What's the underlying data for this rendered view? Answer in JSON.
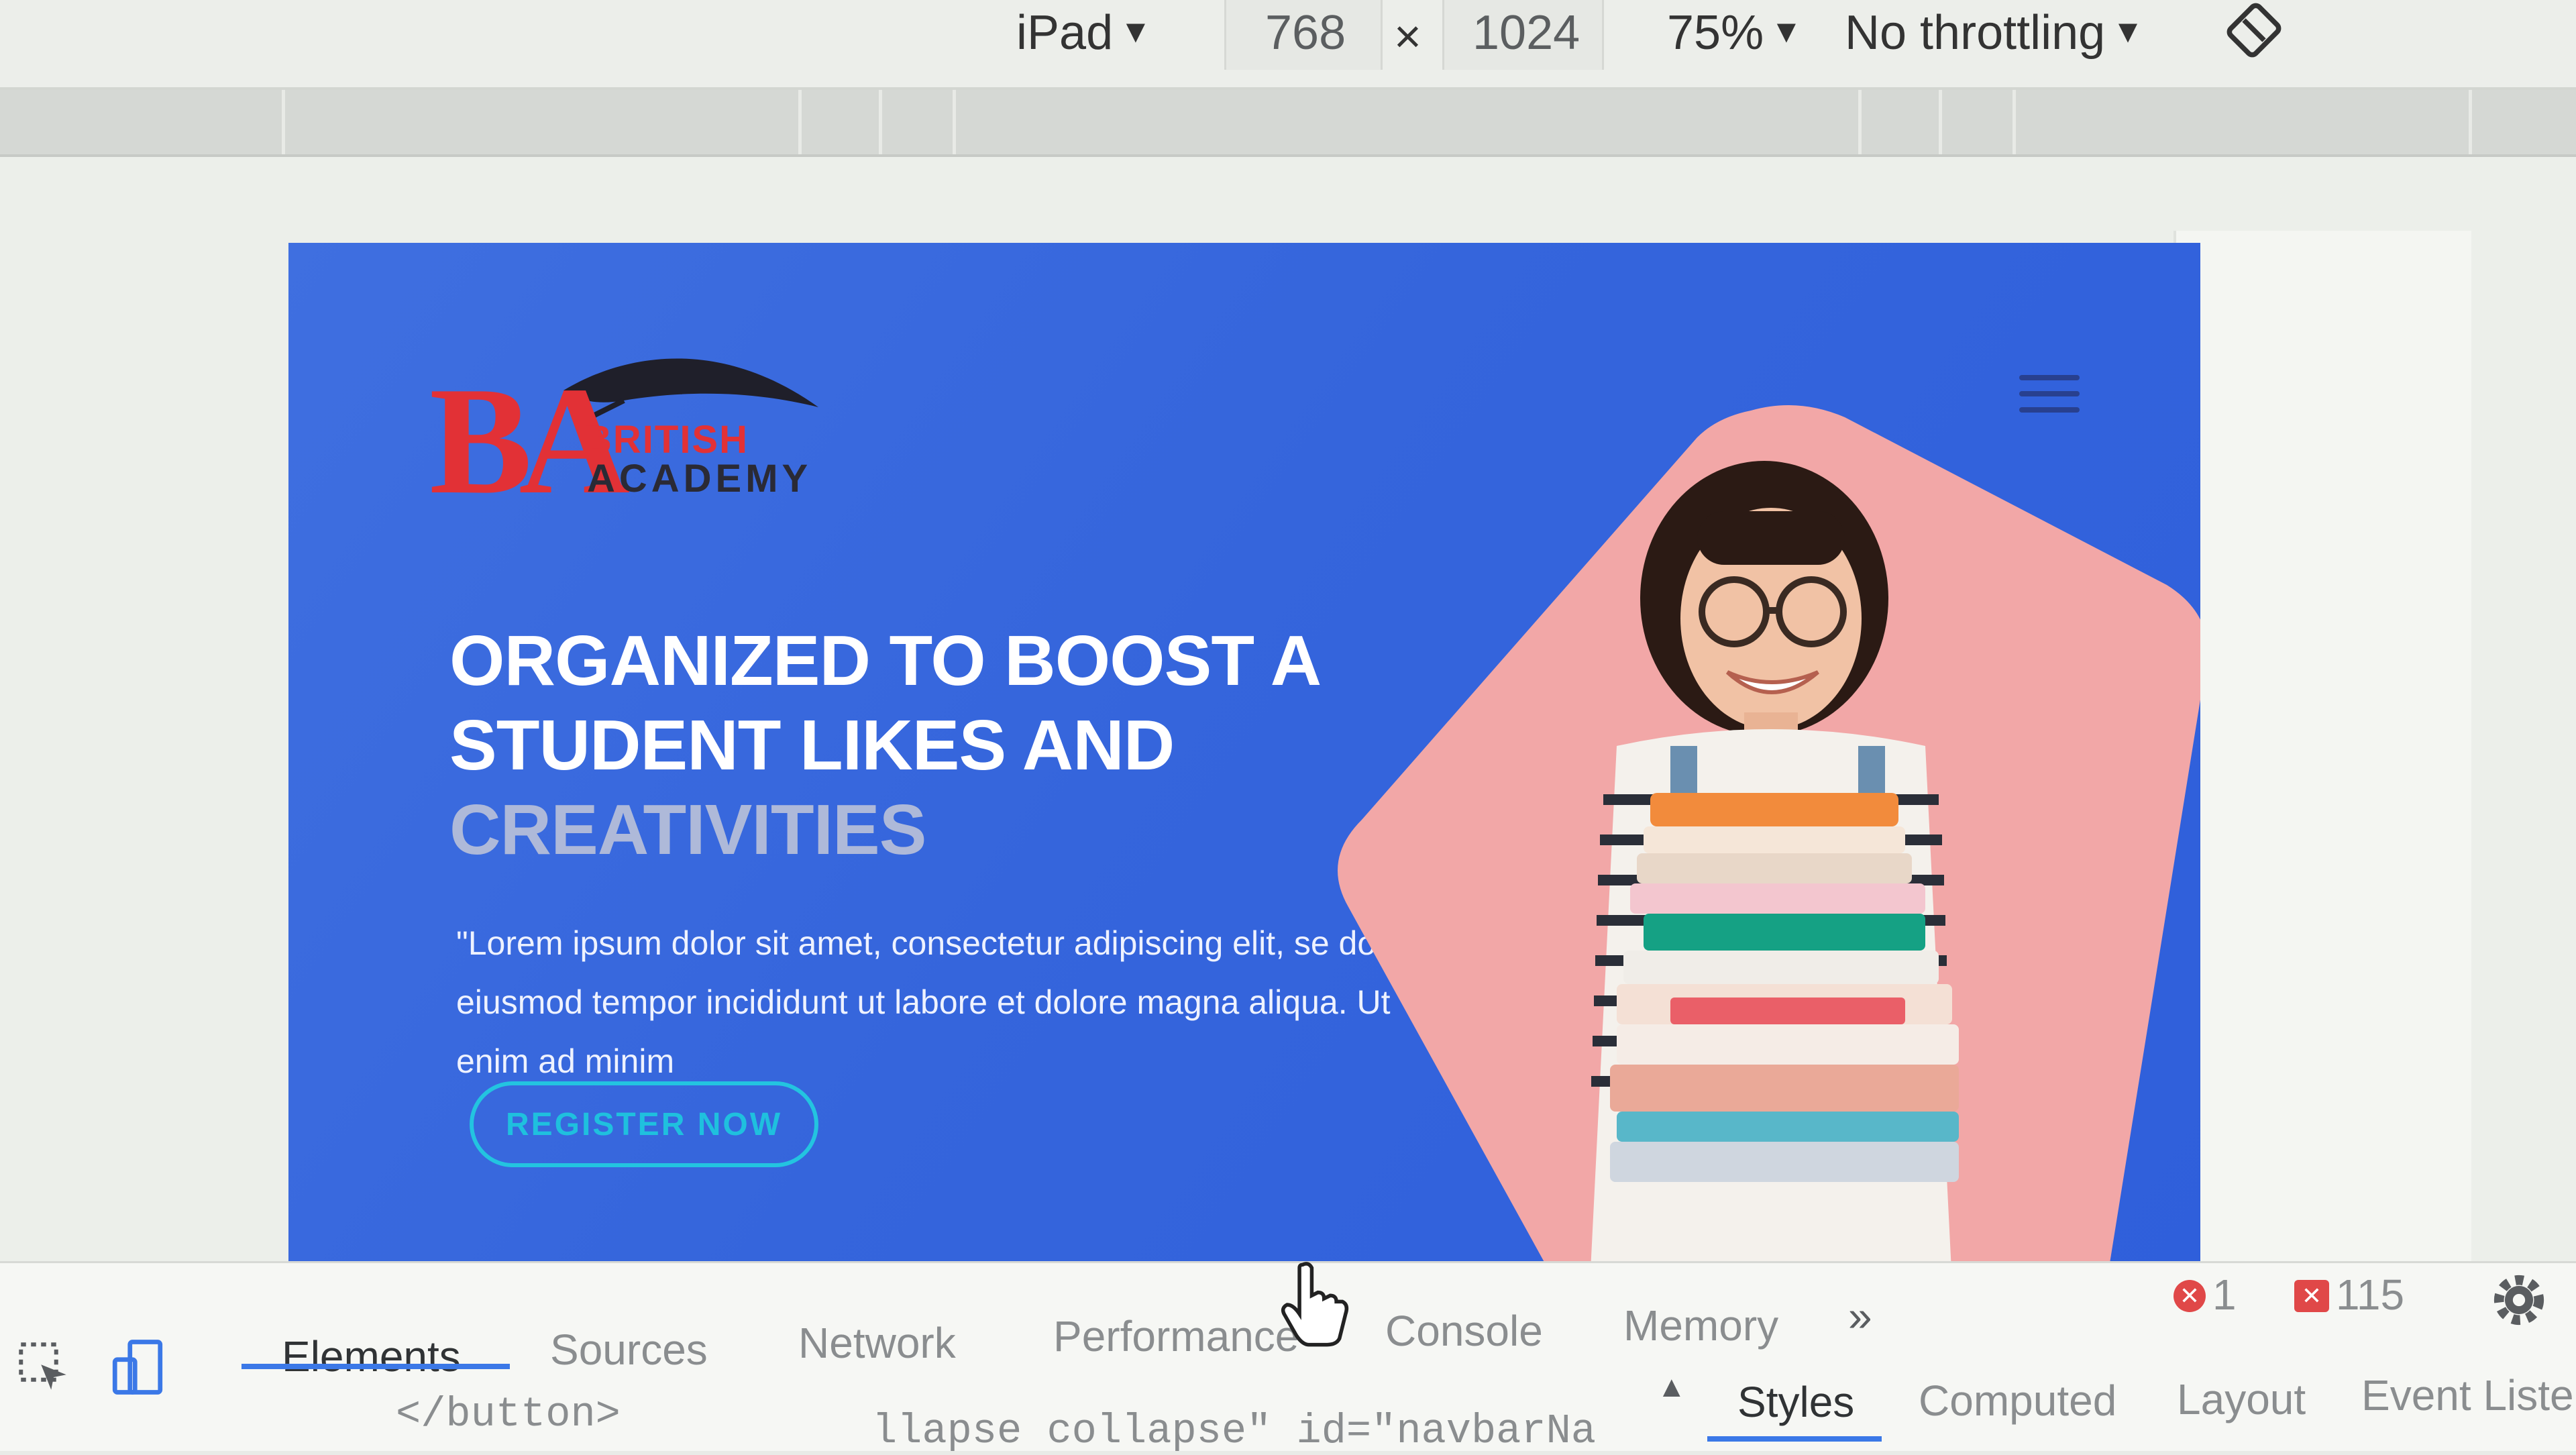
{
  "device_toolbar": {
    "device": "iPad",
    "width": "768",
    "times": "×",
    "height": "1024",
    "zoom": "75%",
    "throttling": "No throttling",
    "caret": "▼",
    "rotate_icon": "rotate-icon"
  },
  "hero": {
    "logo": {
      "mark": "BA",
      "line1": "BRITISH",
      "line2": "ACADEMY"
    },
    "heading_line1": "ORGANIZED TO BOOST A",
    "heading_line2": "STUDENT LIKES AND",
    "heading_accent": "CREATIVITIES",
    "description": "\"Lorem ipsum dolor sit amet, consectetur adipiscing elit, se do eiusmod tempor incididunt ut labore et dolore magna aliqua. Ut enim ad minim",
    "register_label": "REGISTER NOW",
    "colors": {
      "background": "#3565dc",
      "accent_shape": "#f2a7a7",
      "logo_red": "#e23136",
      "button_cyan": "#23c4e0"
    }
  },
  "devtools": {
    "tabs": [
      "Elements",
      "Sources",
      "Network",
      "Performance",
      "Console",
      "Memory"
    ],
    "more_tabs": "»",
    "errors": "1",
    "warnings": "115",
    "code_left": "</button>",
    "code_right": "llapse collapse\" id=\"navbarNa",
    "side_tabs": [
      "Styles",
      "Computed",
      "Layout",
      "Event Listene"
    ],
    "accent": "#3b78e7"
  }
}
